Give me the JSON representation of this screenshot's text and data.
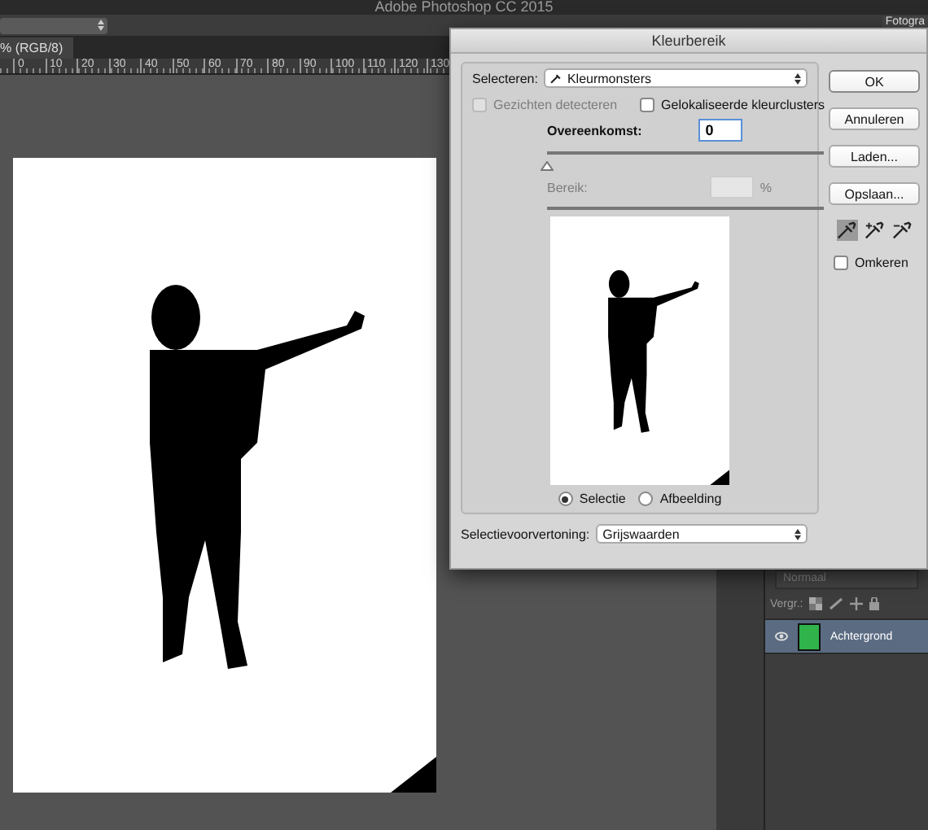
{
  "app": {
    "title": "Adobe Photoshop CC 2015",
    "workspace": "Fotogra"
  },
  "document": {
    "tab": "% (RGB/8)",
    "ruler": [
      "0",
      "10",
      "20",
      "30",
      "40",
      "50",
      "60",
      "70",
      "80",
      "90",
      "100",
      "110",
      "120",
      "130"
    ]
  },
  "dialog": {
    "title": "Kleurbereik",
    "select_label": "Selecteren:",
    "select_value": "Kleurmonsters",
    "options": [
      {
        "label": "Gezichten detecteren",
        "checked": false,
        "disabled": true
      },
      {
        "label": "Gelokaliseerde kleurclusters",
        "checked": false,
        "disabled": false
      }
    ],
    "fuzziness": {
      "label": "Overeenkomst:",
      "value": "0",
      "level": 0
    },
    "range": {
      "label": "Bereik:",
      "unit": "%",
      "disabled": true
    },
    "preview_modes": [
      {
        "label": "Selectie",
        "selected": true
      },
      {
        "label": "Afbeelding",
        "selected": false
      }
    ],
    "preview_label": "Selectievoorvertoning:",
    "preview_value": "Grijswaarden",
    "buttons": [
      "OK",
      "Annuleren",
      "Laden...",
      "Opslaan..."
    ],
    "eyedroppers": [
      {
        "kind": "sample",
        "selected": true
      },
      {
        "kind": "add",
        "selected": false
      },
      {
        "kind": "subtract",
        "selected": false
      }
    ],
    "invert": {
      "label": "Omkeren",
      "checked": false
    }
  },
  "layers": {
    "blend_mode": "Normaal",
    "lock_label": "Vergr.:",
    "items": [
      {
        "name": "Achtergrond",
        "selected": true,
        "visible": true
      }
    ]
  }
}
